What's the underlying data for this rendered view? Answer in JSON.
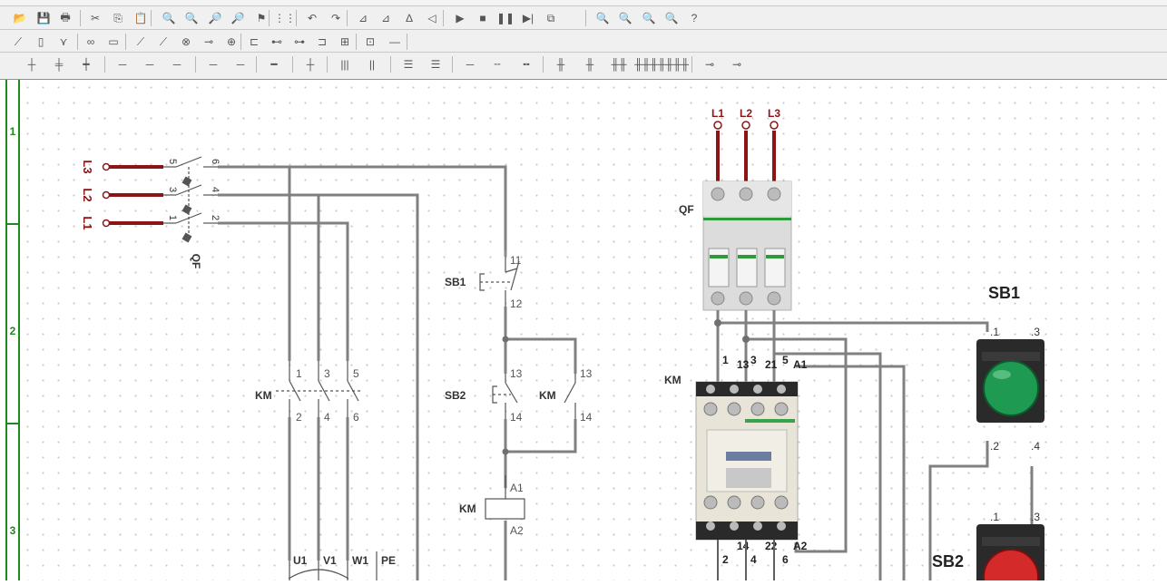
{
  "toolbar1": {
    "buttons": [
      {
        "name": "open-file-icon",
        "glyph": "📂"
      },
      {
        "name": "save-icon",
        "glyph": "💾"
      },
      {
        "name": "print-icon",
        "glyph": "🖶"
      },
      {
        "name": "cut-icon",
        "glyph": "✂"
      },
      {
        "name": "copy-icon",
        "glyph": "⎘"
      },
      {
        "name": "paste-icon",
        "glyph": "📋"
      },
      {
        "name": "find-icon",
        "glyph": "🔍"
      },
      {
        "name": "find-next-icon",
        "glyph": "🔍"
      },
      {
        "name": "find-component-icon",
        "glyph": "🔎"
      },
      {
        "name": "find-net-icon",
        "glyph": "🔎"
      },
      {
        "name": "component-search-icon",
        "glyph": "⚑"
      },
      {
        "name": "grid-icon",
        "glyph": "⋮⋮"
      },
      {
        "name": "undo-icon",
        "glyph": "↶"
      },
      {
        "name": "redo-icon",
        "glyph": "↷"
      },
      {
        "name": "align-left-icon",
        "glyph": "⊿"
      },
      {
        "name": "align-right-icon",
        "glyph": "⊿"
      },
      {
        "name": "flip-icon",
        "glyph": "∆"
      },
      {
        "name": "rotate-icon",
        "glyph": "◁"
      },
      {
        "name": "run-icon",
        "glyph": "▶"
      },
      {
        "name": "stop-icon",
        "glyph": "■"
      },
      {
        "name": "pause-icon",
        "glyph": "❚❚"
      },
      {
        "name": "step-icon",
        "glyph": "▶|"
      },
      {
        "name": "window-icon",
        "glyph": "⧉"
      },
      {
        "name": "zoom-in-icon",
        "glyph": "🔍"
      },
      {
        "name": "zoom-out-icon",
        "glyph": "🔍"
      },
      {
        "name": "zoom-fit-icon",
        "glyph": "🔍"
      },
      {
        "name": "zoom-area-icon",
        "glyph": "🔍"
      },
      {
        "name": "help-icon",
        "glyph": "?"
      }
    ]
  },
  "toolbar2": {
    "buttons": [
      {
        "name": "contact-icon",
        "glyph": "⟋"
      },
      {
        "name": "fuse-icon",
        "glyph": "▯"
      },
      {
        "name": "breaker-icon",
        "glyph": "⋎"
      },
      {
        "name": "transformer-icon",
        "glyph": "∞"
      },
      {
        "name": "coil-icon",
        "glyph": "▭"
      },
      {
        "name": "switch-icon",
        "glyph": "⟋"
      },
      {
        "name": "switch-nc-icon",
        "glyph": "⟋"
      },
      {
        "name": "lamp-icon",
        "glyph": "⊗"
      },
      {
        "name": "terminal-icon",
        "glyph": "⊸"
      },
      {
        "name": "motor-icon",
        "glyph": "⊕"
      },
      {
        "name": "relay-icon",
        "glyph": "⊏"
      },
      {
        "name": "timer-icon",
        "glyph": "⊷"
      },
      {
        "name": "connector-icon",
        "glyph": "⊶"
      },
      {
        "name": "plug-icon",
        "glyph": "⊐"
      },
      {
        "name": "block-icon",
        "glyph": "⊞"
      },
      {
        "name": "meter-icon",
        "glyph": "⊡"
      },
      {
        "name": "wire-icon",
        "glyph": "—"
      }
    ]
  },
  "toolbar3": {
    "buttons": [
      {
        "name": "wire-cross-icon",
        "glyph": "┼"
      },
      {
        "name": "wire-junction-icon",
        "glyph": "╪"
      },
      {
        "name": "wire-tee-icon",
        "glyph": "┿"
      },
      {
        "name": "wire-h-icon",
        "glyph": "─"
      },
      {
        "name": "wire-h2-icon",
        "glyph": "─"
      },
      {
        "name": "wire-h3-icon",
        "glyph": "─"
      },
      {
        "name": "wire-h4-icon",
        "glyph": "─"
      },
      {
        "name": "wire-h5-icon",
        "glyph": "─"
      },
      {
        "name": "wire-thick-icon",
        "glyph": "━"
      },
      {
        "name": "wire-node-icon",
        "glyph": "┼"
      },
      {
        "name": "bus-vertical-icon",
        "glyph": "|||"
      },
      {
        "name": "bus-branch-icon",
        "glyph": "||"
      },
      {
        "name": "bus-horizontal-icon",
        "glyph": "☰"
      },
      {
        "name": "bus-h2-icon",
        "glyph": "☰"
      },
      {
        "name": "line-icon",
        "glyph": "─"
      },
      {
        "name": "line2-icon",
        "glyph": "╌"
      },
      {
        "name": "line3-icon",
        "glyph": "╍"
      },
      {
        "name": "vert-contact-icon",
        "glyph": "╫"
      },
      {
        "name": "vert-contact2-icon",
        "glyph": "╫"
      },
      {
        "name": "multi-contact-icon",
        "glyph": "╫╫"
      },
      {
        "name": "multi-contact3-icon",
        "glyph": "╫╫╫"
      },
      {
        "name": "multi-contact4-icon",
        "glyph": "╫╫╫╫"
      },
      {
        "name": "probe-icon",
        "glyph": "⊸"
      },
      {
        "name": "probe2-icon",
        "glyph": "⊸"
      }
    ]
  },
  "ruler": {
    "rows": [
      "1",
      "2",
      "3"
    ]
  },
  "schematic": {
    "qf_terminals_top": [
      "5",
      "3",
      "1"
    ],
    "qf_terminals_bottom": [
      "6",
      "4",
      "2"
    ],
    "qf_phase_labels": [
      "L3",
      "L2",
      "L1"
    ],
    "qf_label": "QF",
    "km_power_label": "KM",
    "km_power_top": [
      "1",
      "3",
      "5"
    ],
    "km_power_bottom": [
      "2",
      "4",
      "6"
    ],
    "sb1_label": "SB1",
    "sb1_terms": [
      "11",
      "12"
    ],
    "sb2_label": "SB2",
    "sb2_terms": [
      "13",
      "14"
    ],
    "km_aux_label": "KM",
    "km_aux_terms": [
      "13",
      "14"
    ],
    "coil_label": "KM",
    "coil_terms": [
      "A1",
      "A2"
    ],
    "motor_terms": [
      "U1",
      "V1",
      "W1",
      "PE"
    ]
  },
  "wiring": {
    "phases": [
      "L1",
      "L2",
      "L3"
    ],
    "qf_label": "QF",
    "km_label": "KM",
    "km_top_labels": [
      "1",
      "13",
      "3",
      "21",
      "5",
      "A1"
    ],
    "km_bottom_labels": [
      "2",
      "14",
      "4",
      "22",
      "6",
      "A2"
    ],
    "sb1_title": "SB1",
    "sb2_title": "SB2",
    "button_terms": [
      ".1",
      ".3",
      ".2",
      ".4"
    ],
    "colors": {
      "phase": "#8b1414",
      "wire": "#808080",
      "sb1": "#1f9a52",
      "sb2": "#d42a2a"
    }
  }
}
